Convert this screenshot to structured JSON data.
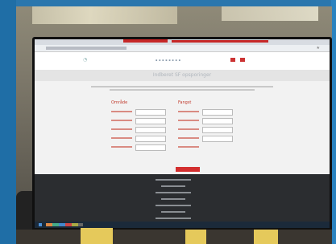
{
  "scene": {
    "page_title": "Indberet SF opsporinger",
    "section_left_title": "Område",
    "section_right_title": "Fangst"
  }
}
